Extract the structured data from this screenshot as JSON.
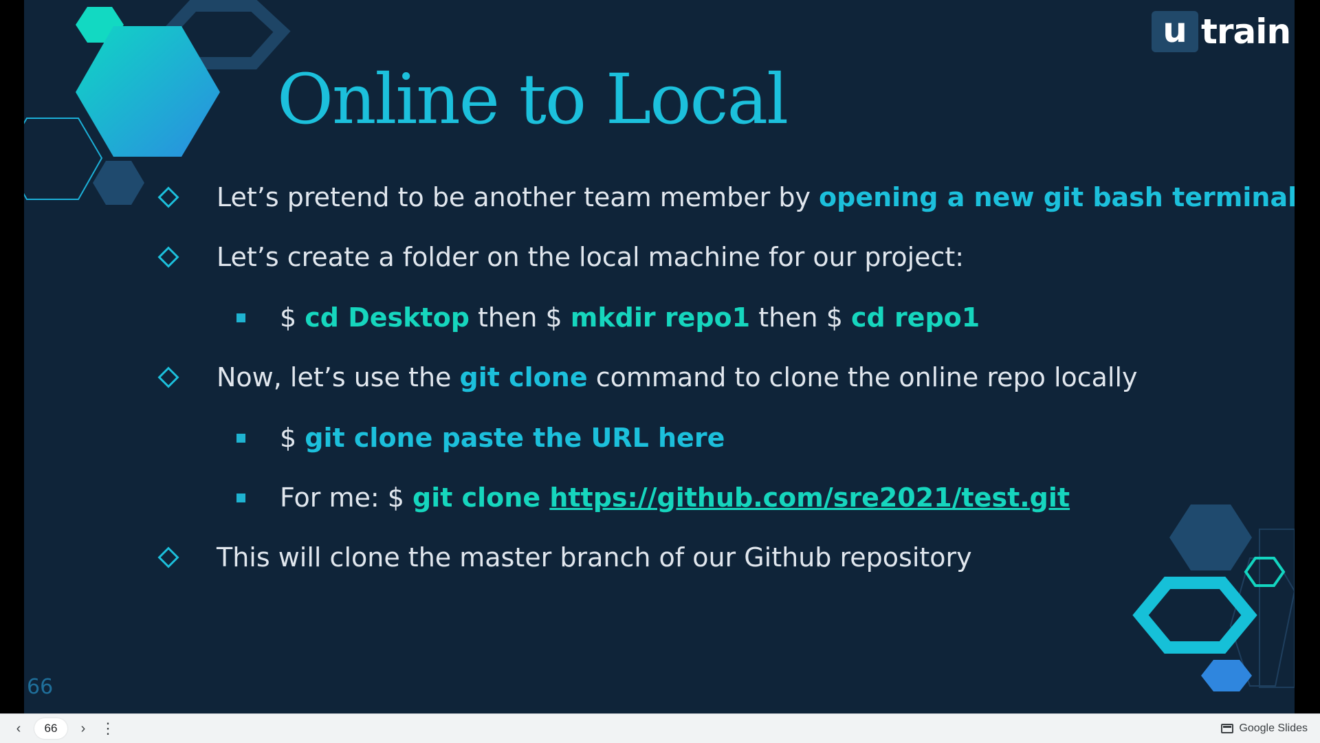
{
  "slide": {
    "title": "Online to Local",
    "logo": {
      "box": "u",
      "word": "train"
    },
    "page_number": "66",
    "bullets": {
      "b1": {
        "text": "Let’s pretend to be another team member by ",
        "highlight": "opening a new git bash terminal"
      },
      "b2": {
        "text": "Let’s create a folder on the local machine for our project:"
      },
      "b2_sub": {
        "p1": "$ ",
        "cmd1": "cd Desktop",
        "p2": " then $ ",
        "cmd2": "mkdir repo1",
        "p3": " then $ ",
        "cmd3": "cd repo1"
      },
      "b3": {
        "text1": "Now, let’s use the ",
        "highlight": "git clone",
        "text2": " command to clone the online repo locally"
      },
      "b3_sub1": {
        "prefix": "$ ",
        "cmd": "git clone paste the URL here"
      },
      "b3_sub2": {
        "prefix": "For me: $ ",
        "cmd": "git clone ",
        "url": "https://github.com/sre2021/test.git"
      },
      "b4": {
        "text": "This will clone the master branch of our Github repository"
      }
    },
    "colors": {
      "background": "#0f2439",
      "accent": "#1cc0dc",
      "accent2": "#16d6be",
      "text": "#e1e7ee"
    }
  },
  "toolbar": {
    "prev_icon": "chevron-left-icon",
    "page": "66",
    "next_icon": "chevron-right-icon",
    "menu_icon": "more-vert-icon",
    "brand": "Google Slides"
  }
}
